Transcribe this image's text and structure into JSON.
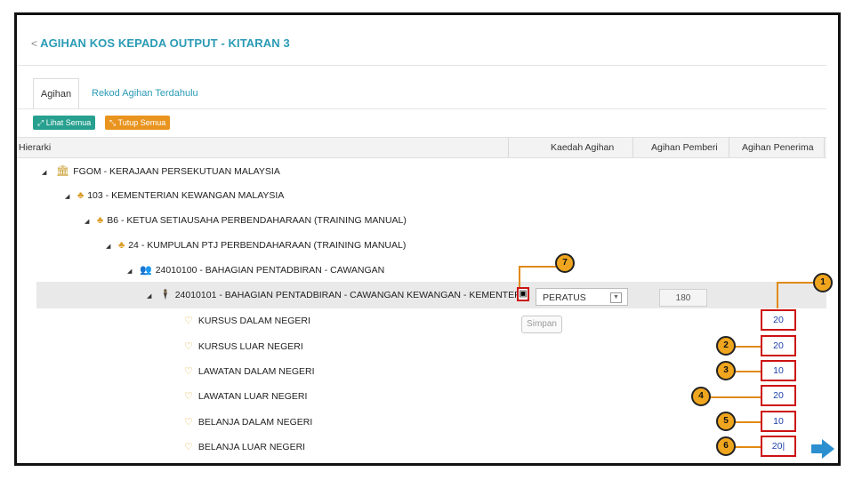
{
  "page": {
    "title": "AGIHAN KOS KEPADA OUTPUT - KITARAN 3",
    "tabs": [
      {
        "label": "Agihan",
        "active": true
      },
      {
        "label": "Rekod Agihan Terdahulu",
        "active": false
      }
    ],
    "buttons": {
      "show_all": "Lihat Semua",
      "hide_all": "Tutup Semua"
    }
  },
  "table": {
    "headers": [
      "Hierarki",
      "Kaedah Agihan",
      "Agihan Pemberi",
      "Agihan Penerima"
    ],
    "tree": [
      {
        "label": "FGOM - KERAJAAN PERSEKUTUAN MALAYSIA",
        "icon": "bank-icon"
      },
      {
        "label": "103 - KEMENTERIAN KEWANGAN MALAYSIA",
        "icon": "org-chart-icon"
      },
      {
        "label": "B6 - KETUA SETIAUSAHA PERBENDAHARAAN (TRAINING MANUAL)",
        "icon": "org-chart-icon"
      },
      {
        "label": "24 - KUMPULAN PTJ PERBENDAHARAAN (TRAINING MANUAL)",
        "icon": "org-chart-icon"
      },
      {
        "label": "24010100 - BAHAGIAN PENTADBIRAN - CAWANGAN",
        "icon": "group-icon"
      },
      {
        "label": "24010101 - BAHAGIAN PENTADBIRAN - CAWANGAN KEWANGAN - KEMENTEF",
        "icon": "person-icon"
      }
    ],
    "selected_row": {
      "method": "PERATUS",
      "giver": "180"
    },
    "save_tooltip": "Simpan",
    "items": [
      {
        "label": "KURSUS DALAM NEGERI",
        "value": "20"
      },
      {
        "label": "KURSUS LUAR NEGERI",
        "value": "20"
      },
      {
        "label": "LAWATAN DALAM NEGERI",
        "value": "10"
      },
      {
        "label": "LAWATAN LUAR NEGERI",
        "value": "20"
      },
      {
        "label": "BELANJA DALAM NEGERI",
        "value": "10"
      },
      {
        "label": "BELANJA LUAR NEGERI",
        "value": "20|"
      }
    ]
  },
  "callouts": [
    "1",
    "2",
    "3",
    "4",
    "5",
    "6",
    "7"
  ],
  "colors": {
    "accent": "#2a9bb5",
    "callout": "#f0a51e",
    "highlight": "#cc1111",
    "arrow": "#2b8fd0"
  }
}
